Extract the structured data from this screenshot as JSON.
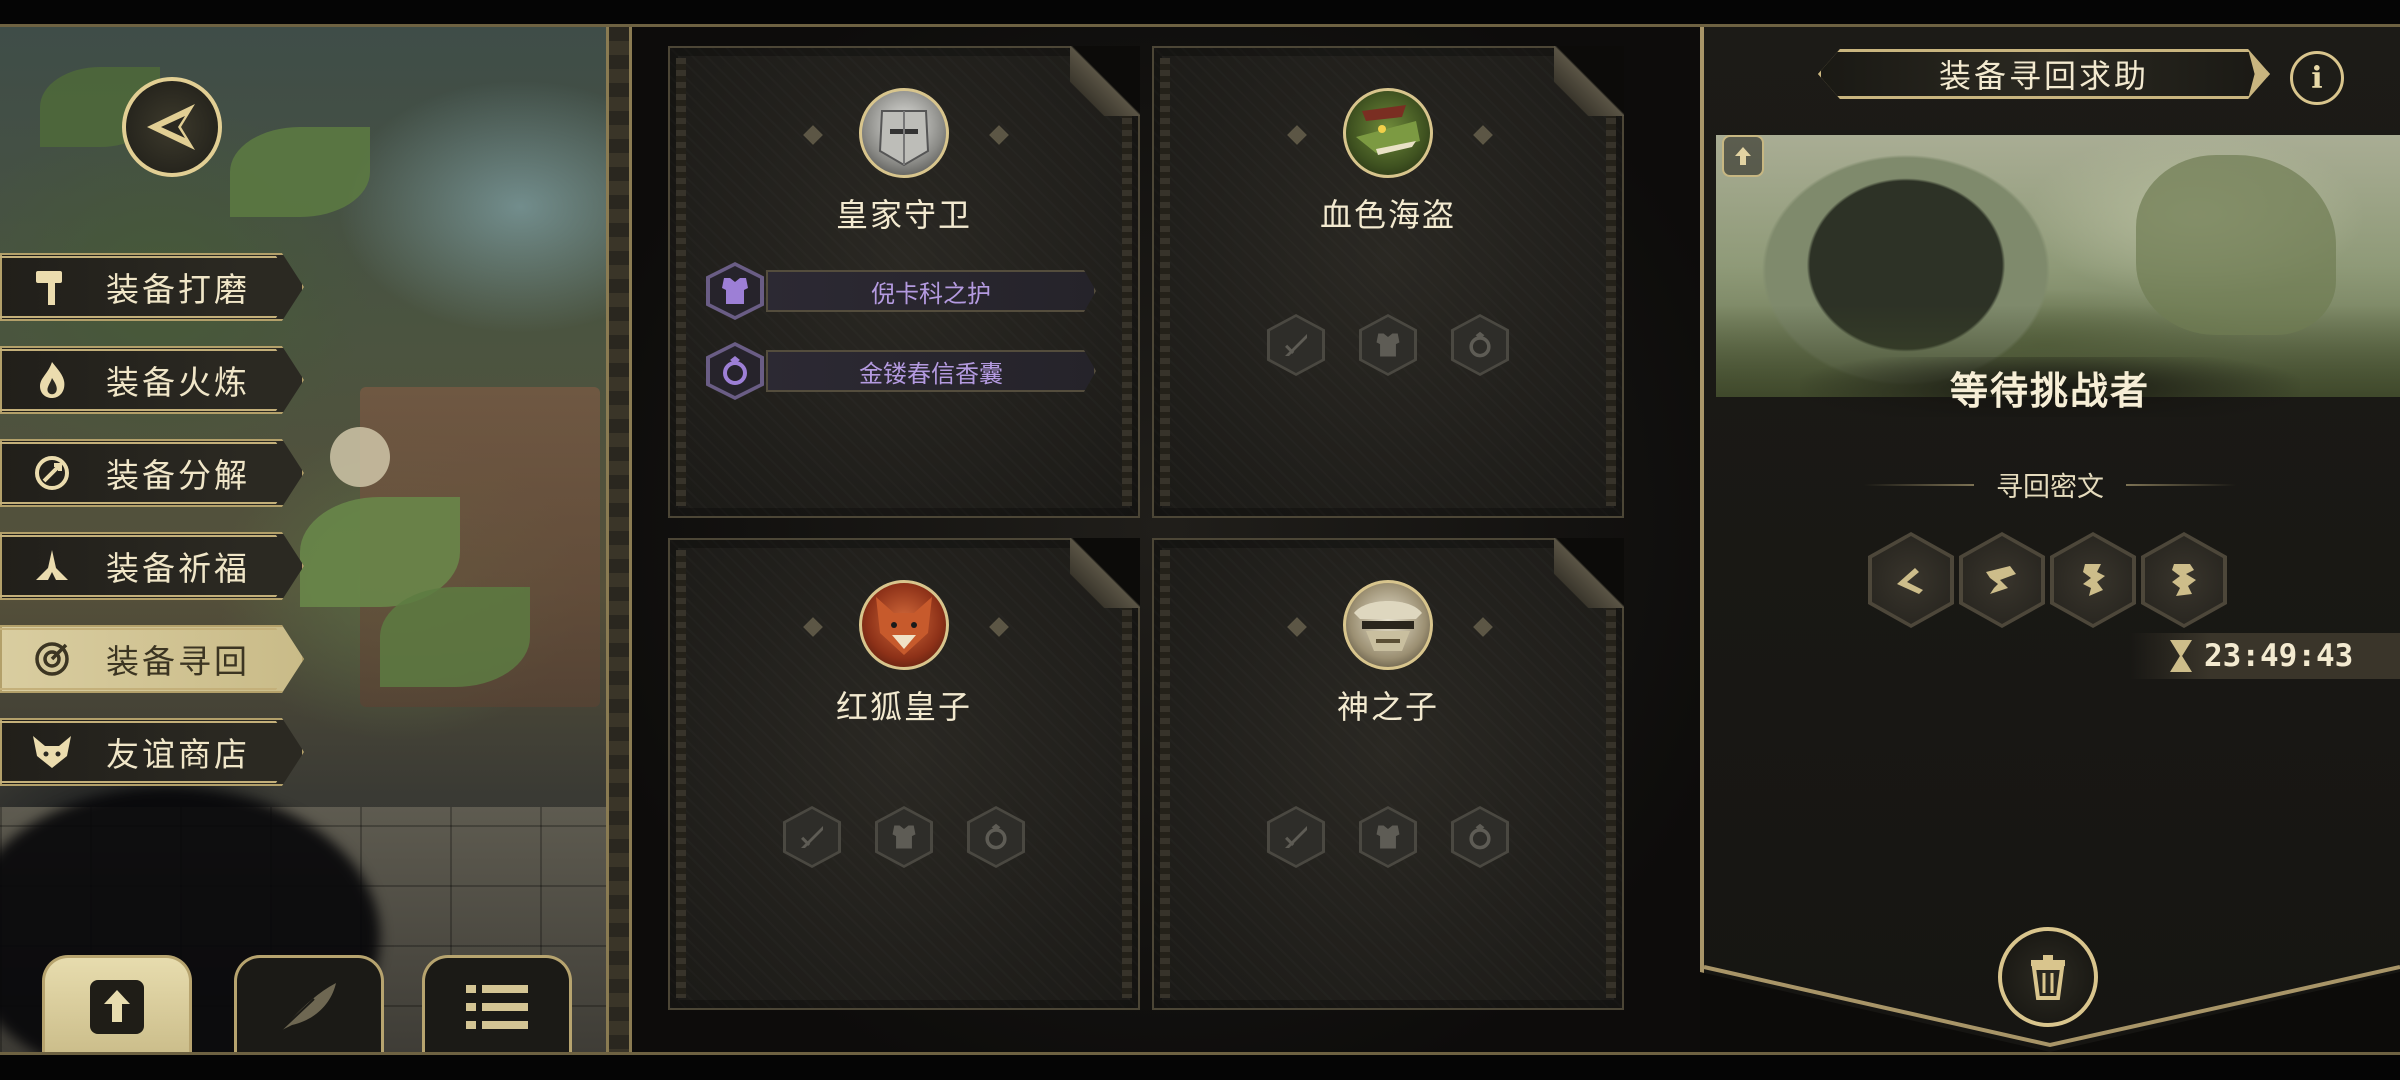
{
  "menu": {
    "items": [
      {
        "label": "装备打磨",
        "icon": "hammer-icon",
        "active": false
      },
      {
        "label": "装备火炼",
        "icon": "flame-icon",
        "active": false
      },
      {
        "label": "装备分解",
        "icon": "disassemble-icon",
        "active": false
      },
      {
        "label": "装备祈福",
        "icon": "pray-hands-icon",
        "active": false
      },
      {
        "label": "装备寻回",
        "icon": "target-icon",
        "active": true
      },
      {
        "label": "友谊商店",
        "icon": "fox-icon",
        "active": false
      }
    ]
  },
  "bottom_buttons": [
    {
      "icon": "upload-icon",
      "active": true
    },
    {
      "icon": "feather-icon",
      "active": false
    },
    {
      "icon": "list-icon",
      "active": false
    }
  ],
  "cards": [
    {
      "name": "皇家守卫",
      "avatar": "knight-helmet-avatar",
      "equipped": [
        {
          "icon": "armor-icon",
          "label": "倪卡科之护"
        },
        {
          "icon": "ring-icon",
          "label": "金镂春信香囊"
        }
      ]
    },
    {
      "name": "血色海盗",
      "avatar": "lizard-pirate-avatar",
      "slots": [
        "sword-slot-icon",
        "armor-slot-icon",
        "ring-slot-icon"
      ]
    },
    {
      "name": "红狐皇子",
      "avatar": "red-fox-avatar",
      "slots": [
        "sword-slot-icon",
        "armor-slot-icon",
        "ring-slot-icon"
      ]
    },
    {
      "name": "神之子",
      "avatar": "masked-warrior-avatar",
      "slots": [
        "sword-slot-icon",
        "armor-slot-icon",
        "ring-slot-icon"
      ]
    }
  ],
  "right_panel": {
    "title": "装备寻回求助",
    "info_label": "i",
    "status": "等待挑战者",
    "cipher_title": "寻回密文",
    "runes": [
      "rune-1-icon",
      "rune-2-icon",
      "rune-3-icon",
      "rune-4-icon"
    ],
    "timer": "23:49:43"
  },
  "colors": {
    "gold": "#d9c58d",
    "equip_purple": "#b49ae0",
    "panel_dark": "#1b1a17"
  }
}
